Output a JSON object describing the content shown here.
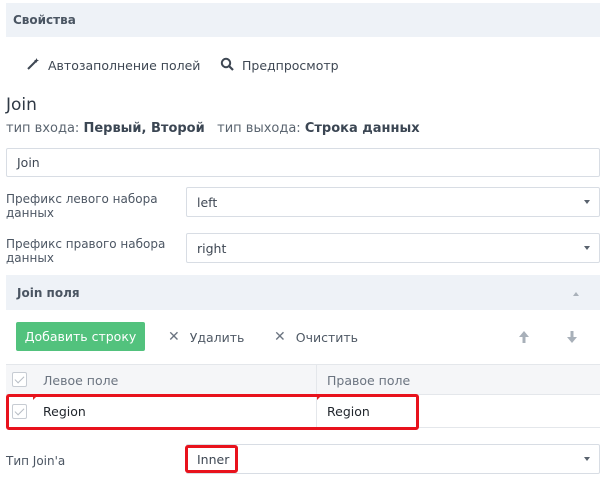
{
  "panel": {
    "title": "Свойства"
  },
  "toolbar": {
    "autofill_label": "Автозаполнение полей",
    "preview_label": "Предпросмотр"
  },
  "node": {
    "title": "Join",
    "input_type_label": "тип входа:",
    "input_type_value": "Первый, Второй",
    "output_type_label": "тип выхода:",
    "output_type_value": "Строка данных",
    "name_value": "Join"
  },
  "left_prefix": {
    "label": "Префикс левого набора данных",
    "value": "left"
  },
  "right_prefix": {
    "label": "Префикс правого набора данных",
    "value": "right"
  },
  "join_fields": {
    "section_title": "Join поля",
    "add_row_label": "Добавить строку",
    "delete_label": "Удалить",
    "clear_label": "Очистить",
    "columns": [
      "Левое поле",
      "Правое поле"
    ],
    "rows": [
      {
        "left": "Region",
        "right": "Region"
      }
    ]
  },
  "join_type": {
    "label": "Тип Join'а",
    "value": "Inner"
  },
  "colors": {
    "add_button": "#52c27d",
    "highlight": "#e8121c",
    "header_bg": "#eef2f7"
  }
}
